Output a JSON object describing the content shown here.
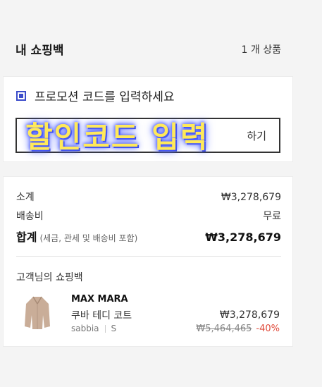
{
  "header": {
    "title": "내 쇼핑백",
    "item_count": "1 개 상품"
  },
  "promo": {
    "checkbox_label": "프로모션 코드를 입력하세요",
    "input_placeholder": "",
    "apply_label": "하기",
    "overlay_caption": "할인코드 입력",
    "accent_color": "#3b4cca"
  },
  "summary": {
    "subtotal_label": "소계",
    "subtotal_value": "₩3,278,679",
    "shipping_label": "배송비",
    "shipping_value": "무료",
    "total_label": "합계",
    "total_note": "(세금, 관세 및 배송비 포함)",
    "total_value": "₩3,278,679"
  },
  "bag": {
    "section_title": "고객님의 쇼핑백",
    "items": [
      {
        "brand": "MAX MARA",
        "name": "쿠바 테디 코트",
        "color": "sabbia",
        "size": "S",
        "price": "₩3,278,679",
        "original_price": "₩5,464,465",
        "discount": "-40%",
        "thumbnail_icon": "teddy-coat-image"
      }
    ]
  }
}
